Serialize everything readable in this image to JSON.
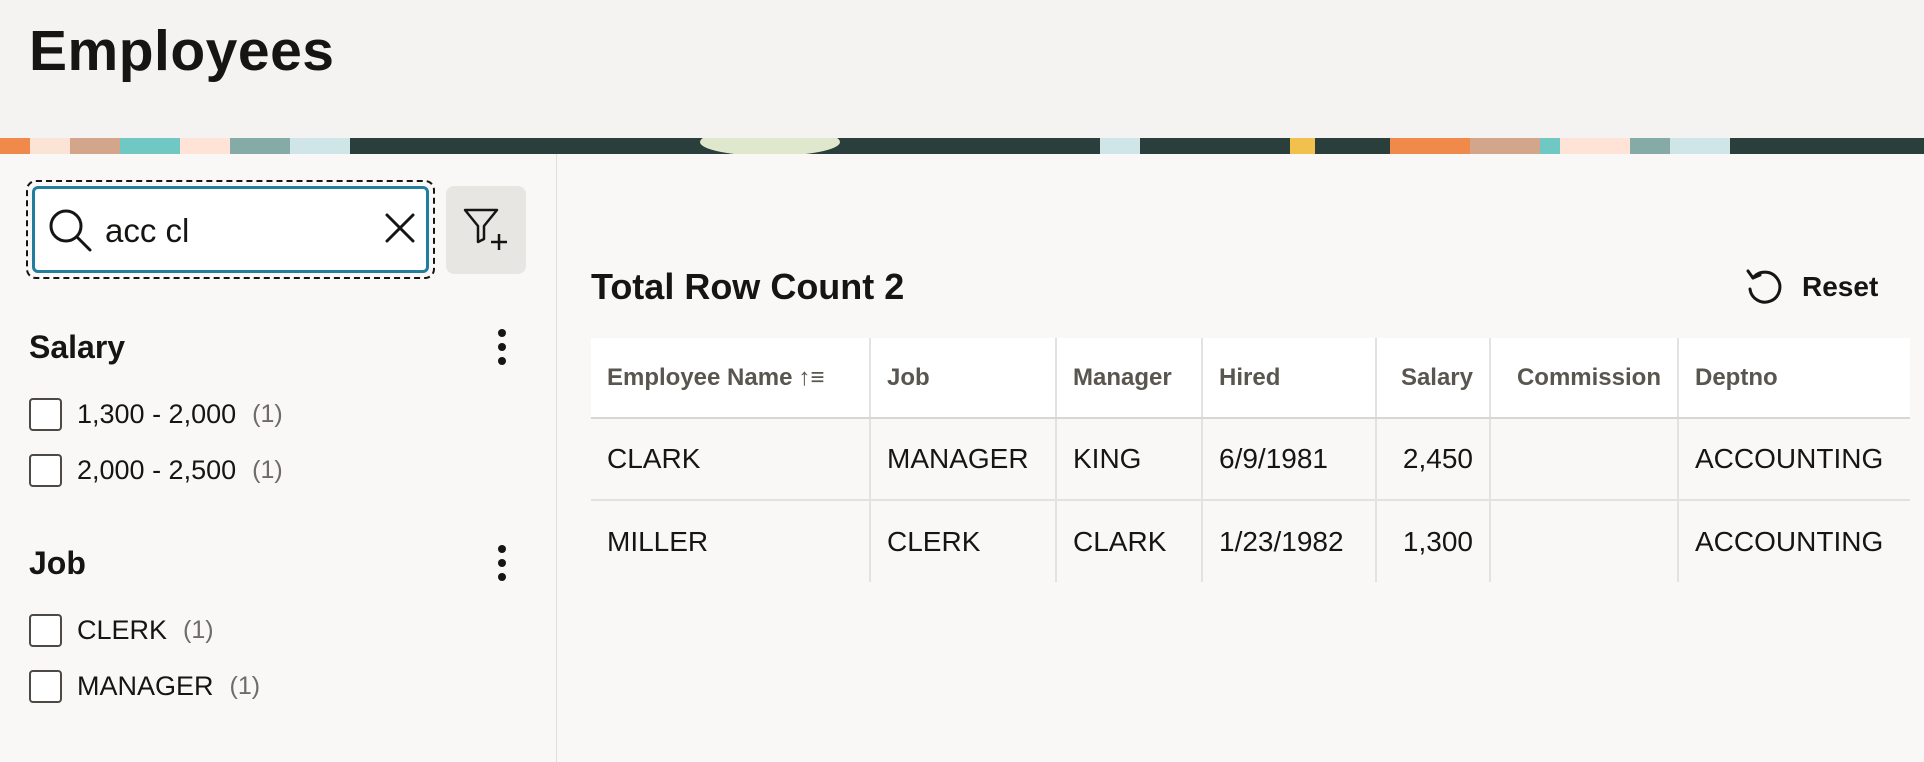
{
  "page": {
    "title": "Employees"
  },
  "search": {
    "value": "acc cl",
    "placeholder": ""
  },
  "facets": [
    {
      "title": "Salary",
      "options": [
        {
          "label": "1,300 - 2,000",
          "count": "(1)"
        },
        {
          "label": "2,000 - 2,500",
          "count": "(1)"
        }
      ]
    },
    {
      "title": "Job",
      "options": [
        {
          "label": "CLERK",
          "count": "(1)"
        },
        {
          "label": "MANAGER",
          "count": "(1)"
        }
      ]
    }
  ],
  "results": {
    "row_count_label": "Total Row Count 2",
    "reset_label": "Reset"
  },
  "table": {
    "columns": [
      "Employee Name",
      "Job",
      "Manager",
      "Hired",
      "Salary",
      "Commission",
      "Deptno"
    ],
    "sort_indicator": "↑≡",
    "rows": [
      [
        "CLARK",
        "MANAGER",
        "KING",
        "6/9/1981",
        "2,450",
        "",
        "ACCOUNTING"
      ],
      [
        "MILLER",
        "CLERK",
        "CLARK",
        "1/23/1982",
        "1,300",
        "",
        "ACCOUNTING"
      ]
    ]
  },
  "icons": {
    "search": "search-icon",
    "clear": "close-icon",
    "filter": "filter-add-icon",
    "kebab": "more-vertical-icon",
    "reset": "undo-icon"
  },
  "colors": {
    "accent": "#227e9e",
    "header_bg": "#f4f3f1",
    "page_bg": "#f9f8f6"
  }
}
